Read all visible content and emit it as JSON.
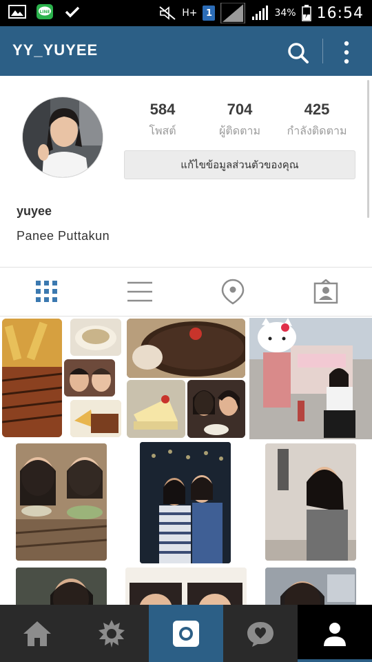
{
  "status_bar": {
    "battery_text": "34%",
    "time": "16:54",
    "network_text": "H+",
    "sim_badge": "1",
    "icons": [
      "image-icon",
      "line-app-icon",
      "check-icon",
      "mute-icon",
      "network-h-plus-icon",
      "sim-icon",
      "signal-icon",
      "signal-icon",
      "battery-charging-icon"
    ]
  },
  "app_bar": {
    "title": "YY_YUYEE",
    "icons": [
      "search-icon",
      "more-vert-icon"
    ],
    "bg_color": "#2c5f86"
  },
  "profile": {
    "stats": [
      {
        "value": "584",
        "label": "โพสต์"
      },
      {
        "value": "704",
        "label": "ผู้ติดตาม"
      },
      {
        "value": "425",
        "label": "กำลังติดตาม"
      }
    ],
    "edit_button": "แก้ไขข้อมูลส่วนตัวของคุณ",
    "username": "yuyee",
    "full_name": "Panee Puttakun"
  },
  "tabs": [
    {
      "icon": "grid-icon",
      "active": true
    },
    {
      "icon": "list-icon",
      "active": false
    },
    {
      "icon": "location-pin-icon",
      "active": false
    },
    {
      "icon": "tagged-person-icon",
      "active": false
    }
  ],
  "bottom_nav": [
    {
      "icon": "home-icon",
      "active": false
    },
    {
      "icon": "explore-icon",
      "active": false
    },
    {
      "icon": "camera-icon",
      "active": false
    },
    {
      "icon": "activity-heart-icon",
      "active": false
    },
    {
      "icon": "profile-icon",
      "active": true
    }
  ],
  "colors": {
    "accent": "#2c5f86",
    "active_tab": "#3b79b0",
    "inactive_icon": "#8c8c8c",
    "bottom_bg": "#2a2a2a"
  }
}
